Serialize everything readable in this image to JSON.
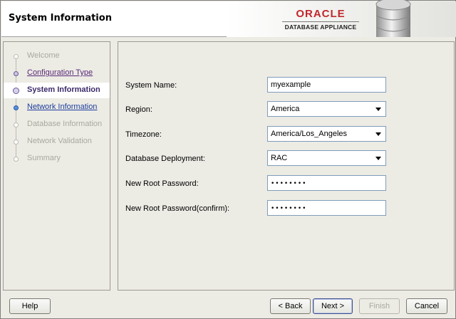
{
  "header": {
    "title": "System Information",
    "brand_name": "ORACLE",
    "brand_sub": "DATABASE APPLIANCE",
    "brand_color": "#c0282d",
    "icon": "database-cylinder-icon"
  },
  "nav": {
    "items": [
      {
        "label": "Welcome",
        "state": "disabled"
      },
      {
        "label": "Configuration Type",
        "state": "visited"
      },
      {
        "label": "System Information",
        "state": "current"
      },
      {
        "label": "Network Information",
        "state": "link"
      },
      {
        "label": "Database Information",
        "state": "disabled"
      },
      {
        "label": "Network Validation",
        "state": "disabled"
      },
      {
        "label": "Summary",
        "state": "disabled"
      }
    ]
  },
  "form": {
    "system_name": {
      "label": "System Name:",
      "value": "myexample"
    },
    "region": {
      "label": "Region:",
      "value": "America"
    },
    "timezone": {
      "label": "Timezone:",
      "value": "America/Los_Angeles"
    },
    "deployment": {
      "label": "Database Deployment:",
      "value": "RAC"
    },
    "root_password": {
      "label": "New Root Password:",
      "value": "••••••••"
    },
    "root_password_confirm": {
      "label": "New Root Password(confirm):",
      "value": "••••••••"
    }
  },
  "buttons": {
    "help": "Help",
    "back": "< Back",
    "next": "Next >",
    "finish": "Finish",
    "cancel": "Cancel"
  }
}
